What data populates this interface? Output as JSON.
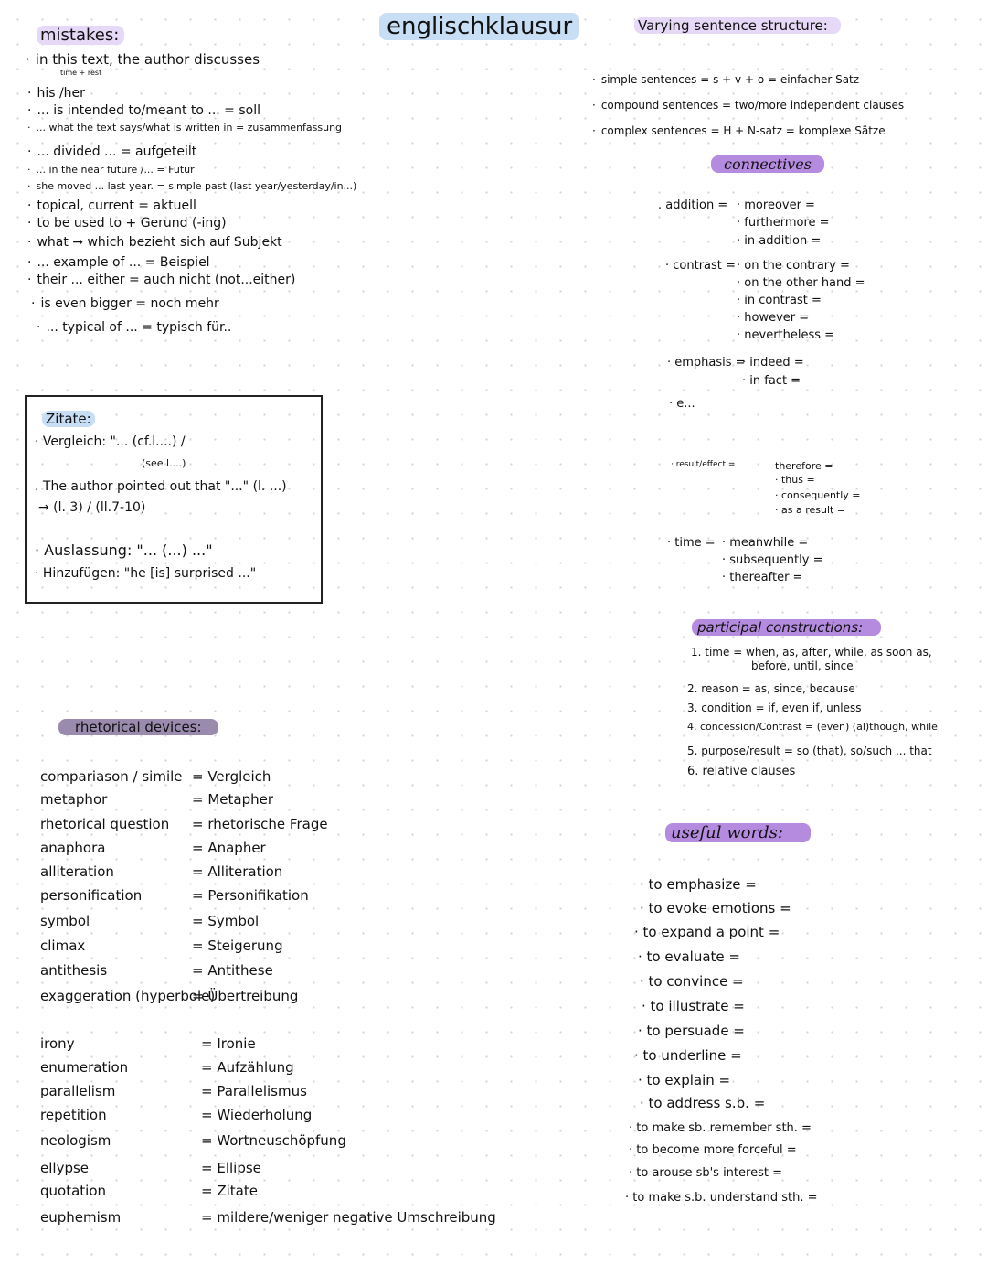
{
  "title": "englischklausur",
  "mistakes": {
    "heading": "mistakes:",
    "items": [
      {
        "text": "in this text, the author discusses",
        "note": "time + rest"
      },
      {
        "text": "his /her"
      },
      {
        "text": "... is intended to/meant to ... = soll"
      },
      {
        "text": "... what the text says/what is written in = zusammenfassung"
      },
      {
        "text": "... divided ... = aufgeteilt"
      },
      {
        "text": "... in the near future /... = Futur"
      },
      {
        "text": "she moved ... last year. = simple past (last year/yesterday/in...)"
      },
      {
        "text": "topical, current = aktuell"
      },
      {
        "text": "to be used to + Gerund (-ing)"
      },
      {
        "text": "what → which bezieht sich auf Subjekt"
      },
      {
        "text": "... example of ... = Beispiel"
      },
      {
        "text": "their ... either = auch nicht (not...either)"
      },
      {
        "text": "is even bigger = noch mehr"
      },
      {
        "text": "... typical of ... = typisch für.."
      }
    ]
  },
  "quotes_box": {
    "heading": "Zitate:",
    "lines": [
      "· Vergleich: \"... (cf.l....) /",
      "(see l....)",
      ". The author pointed out that \"...\" (l. ...)",
      "→ (l. 3) / (ll.7-10)",
      "· Auslassung: \"... (...) ...\"",
      "· Hinzufügen: \"he [is] surprised ...\""
    ]
  },
  "rhetorical_devices": {
    "heading": "rhetorical devices:",
    "items": [
      {
        "en": "compariason / simile",
        "de": "= Vergleich"
      },
      {
        "en": "metaphor",
        "de": "= Metapher"
      },
      {
        "en": "rhetorical question",
        "de": "= rhetorische Frage"
      },
      {
        "en": "anaphora",
        "de": "= Anapher"
      },
      {
        "en": "alliteration",
        "de": "= Alliteration"
      },
      {
        "en": "personification",
        "de": "= Personifikation"
      },
      {
        "en": "symbol",
        "de": "= Symbol"
      },
      {
        "en": "climax",
        "de": "= Steigerung"
      },
      {
        "en": "antithesis",
        "de": "= Antithese"
      },
      {
        "en": "exaggeration (hyperbole)",
        "de": "= Übertreibung"
      },
      {
        "en": "irony",
        "de": "= Ironie"
      },
      {
        "en": "enumeration",
        "de": "= Aufzählung"
      },
      {
        "en": "parallelism",
        "de": "= Parallelismus"
      },
      {
        "en": "repetition",
        "de": "= Wiederholung"
      },
      {
        "en": "neologism",
        "de": "= Wortneuschöpfung"
      },
      {
        "en": "ellypse",
        "de": "= Ellipse"
      },
      {
        "en": "quotation",
        "de": "= Zitate"
      },
      {
        "en": "euphemism",
        "de": "= mildere/weniger negative Umschreibung"
      }
    ]
  },
  "sentence_structure": {
    "heading": "Varying sentence structure:",
    "items": [
      "simple sentences = s + v + o = einfacher Satz",
      "compound sentences = two/more independent clauses",
      "complex sentences = H + N-satz = komplexe Sätze"
    ]
  },
  "connectives": {
    "heading": "connectives",
    "groups": [
      {
        "label": ". addition =",
        "words": [
          "· moreover =",
          "· furthermore =",
          "· in addition ="
        ]
      },
      {
        "label": "· contrast =",
        "words": [
          "· on the contrary =",
          "· on the other hand =",
          "· in contrast =",
          "· however =",
          "· nevertheless ="
        ]
      },
      {
        "label": "· emphasis =",
        "words": [
          "· indeed =",
          "· in fact ="
        ]
      },
      {
        "label": "· e...",
        "words": []
      },
      {
        "label": "· result/effect =",
        "words": [
          "therefore =",
          "· thus =",
          "· consequently =",
          "· as a result ="
        ]
      },
      {
        "label": "· time =",
        "words": [
          "· meanwhile =",
          "· subsequently =",
          "· thereafter ="
        ]
      }
    ]
  },
  "participial": {
    "heading": "participal constructions:",
    "items": [
      "1. time = when, as, after, while, as soon as,",
      "before, until, since",
      "2. reason = as, since, because",
      "3. condition = if, even if, unless",
      "4. concession/Contrast = (even) (al)though, while",
      "5. purpose/result = so (that), so/such ... that",
      "6. relative clauses"
    ]
  },
  "useful_words": {
    "heading": "useful words:",
    "items": [
      "· to emphasize =",
      "· to evoke emotions =",
      "· to expand a point =",
      "· to evaluate =",
      "· to convince =",
      "· to illustrate =",
      "· to persuade =",
      "· to underline =",
      "· to explain =",
      "· to address s.b. =",
      "· to make sb. remember sth. =",
      "· to become more forceful =",
      "· to arouse sb's interest =",
      "· to make s.b. understand sth. ="
    ]
  }
}
